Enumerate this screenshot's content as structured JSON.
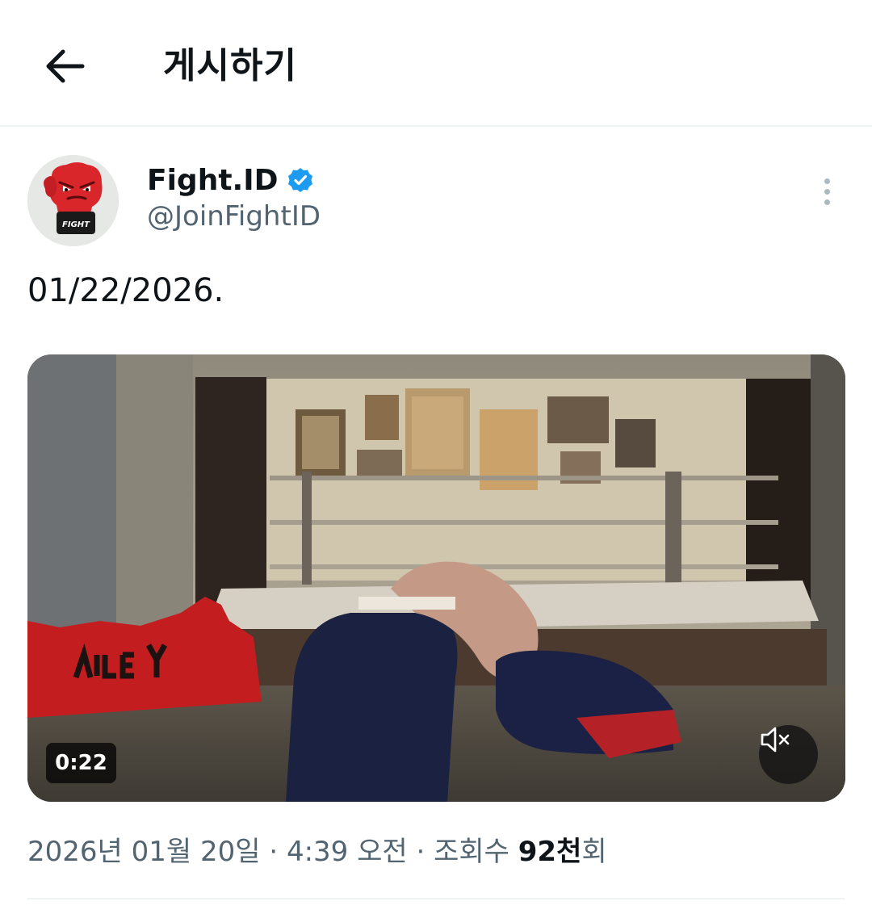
{
  "header": {
    "title": "게시하기",
    "back_icon": "back-arrow-icon"
  },
  "author": {
    "display_name": "Fight.ID",
    "handle": "@JoinFightID",
    "verified": true,
    "verified_color": "#1d9bf0",
    "avatar_text": "FIGHT",
    "avatar_color": "#d8262b"
  },
  "tweet": {
    "text": "01/22/2026."
  },
  "media": {
    "type": "video",
    "duration": "0:22",
    "muted": true,
    "mute_icon": "volume-muted-icon"
  },
  "meta": {
    "date": "2026년 01월 20일",
    "separator": " · ",
    "time": "4:39 오전",
    "views_label": "조회수 ",
    "views_count": "92천",
    "views_suffix": "회"
  },
  "colors": {
    "text_primary": "#0f1419",
    "text_secondary": "#536471",
    "divider": "#eff3f4"
  }
}
